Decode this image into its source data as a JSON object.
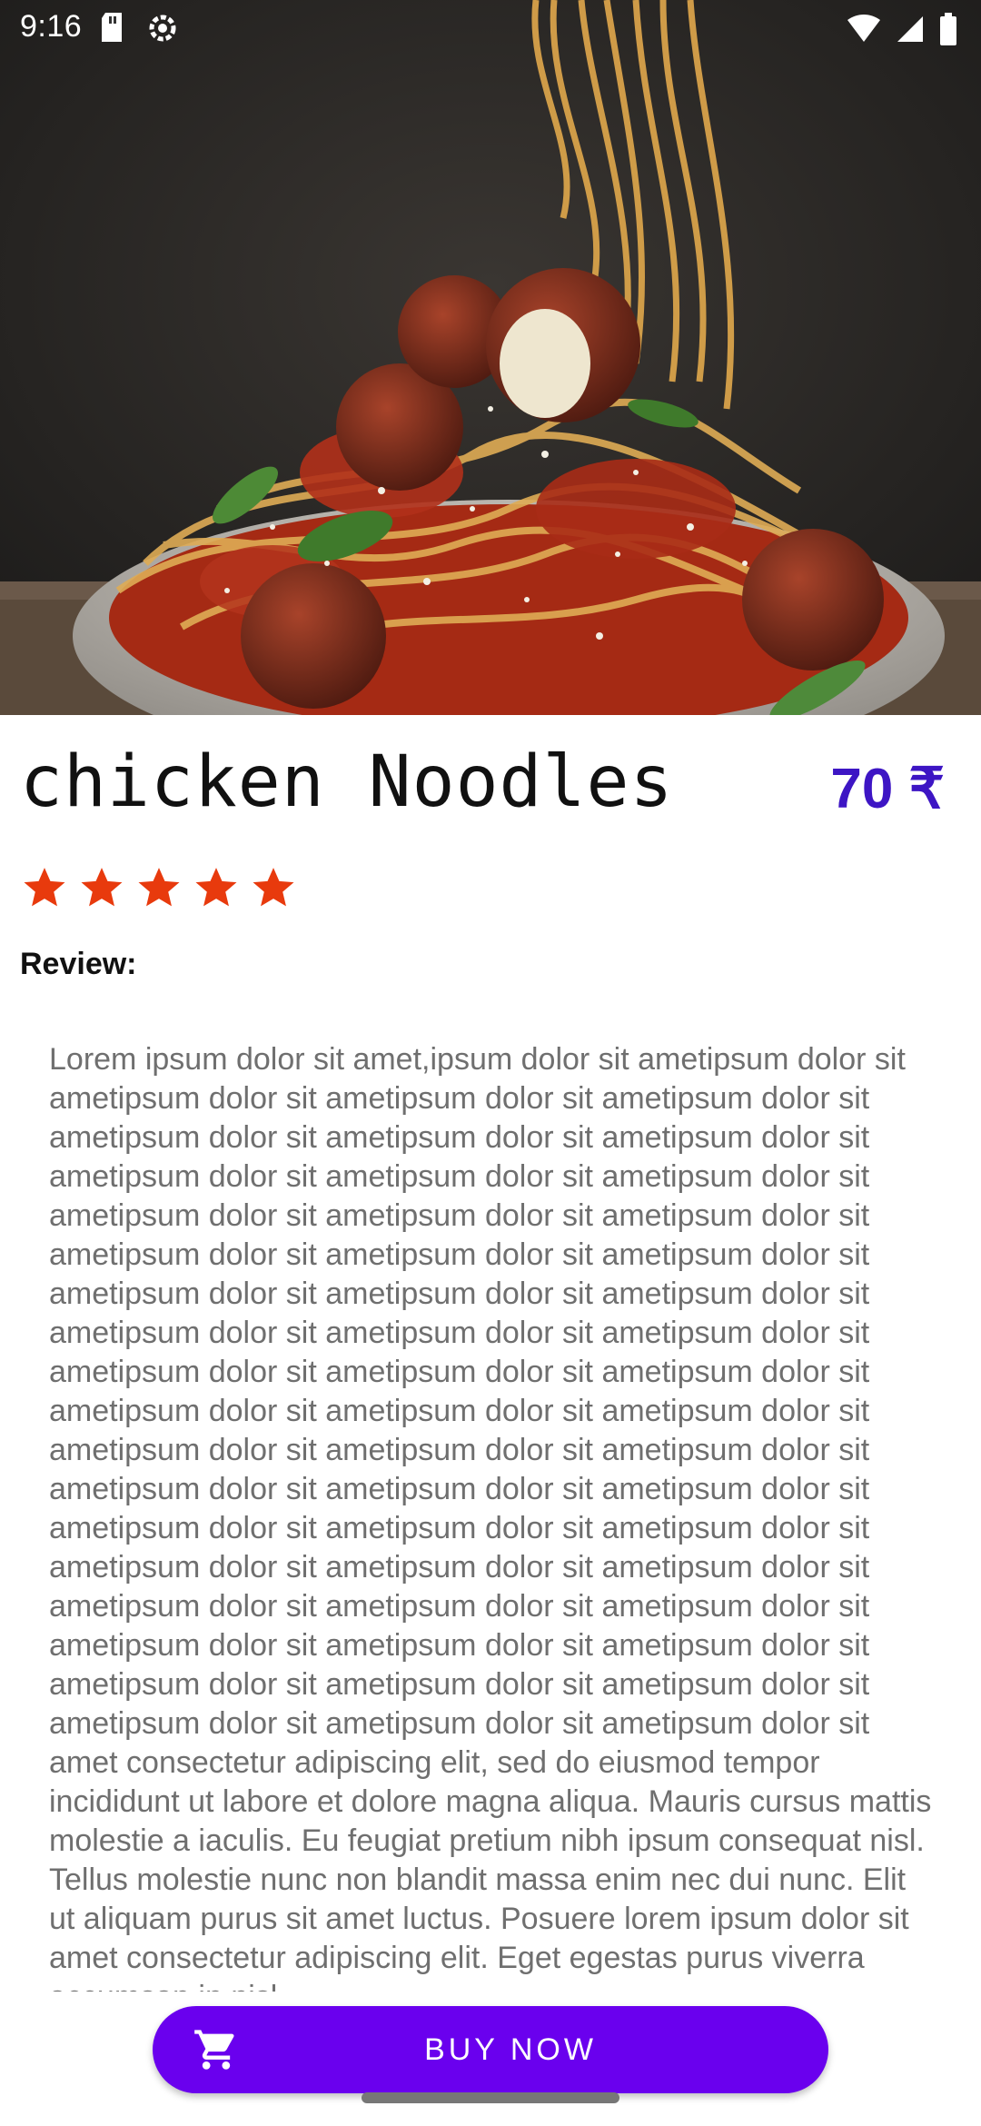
{
  "status_bar": {
    "time": "9:16",
    "left_icons": [
      "sd-card-icon",
      "settings-icon"
    ],
    "right_icons": [
      "wifi-icon",
      "cellular-signal-icon",
      "battery-icon"
    ]
  },
  "hero": {
    "image_subject": "spaghetti-meatballs-photo"
  },
  "product": {
    "title": "chicken Noodles",
    "price": "70 ₹",
    "rating_stars": 5,
    "star_color": "#e83a0d",
    "price_color": "#3d15c4"
  },
  "review": {
    "heading": "Review:",
    "text": "Lorem ipsum dolor sit amet,ipsum dolor sit ametipsum dolor sit ametipsum dolor sit ametipsum dolor sit ametipsum dolor sit ametipsum dolor sit ametipsum dolor sit ametipsum dolor sit ametipsum dolor sit ametipsum dolor sit ametipsum dolor sit ametipsum dolor sit ametipsum dolor sit ametipsum dolor sit ametipsum dolor sit ametipsum dolor sit ametipsum dolor sit ametipsum dolor sit ametipsum dolor sit ametipsum dolor sit ametipsum dolor sit ametipsum dolor sit ametipsum dolor sit ametipsum dolor sit ametipsum dolor sit ametipsum dolor sit ametipsum dolor sit ametipsum dolor sit ametipsum dolor sit ametipsum dolor sit ametipsum dolor sit ametipsum dolor sit ametipsum dolor sit ametipsum dolor sit ametipsum dolor sit ametipsum dolor sit ametipsum dolor sit ametipsum dolor sit ametipsum dolor sit ametipsum dolor sit ametipsum dolor sit ametipsum dolor sit ametipsum dolor sit ametipsum dolor sit ametipsum dolor sit ametipsum dolor sit ametipsum dolor sit ametipsum dolor sit ametipsum dolor sit ametipsum dolor sit ametipsum dolor sit ametipsum dolor sit ametipsum dolor sit amet consectetur adipiscing elit, sed do eiusmod tempor incididunt ut labore et dolore magna aliqua. Mauris cursus mattis molestie a iaculis. Eu feugiat pretium nibh ipsum consequat nisl. Tellus molestie nunc non blandit massa enim nec dui nunc. Elit ut aliquam purus sit amet luctus. Posuere lorem ipsum dolor sit amet consectetur adipiscing elit. Eget egestas purus viverra accumsan in nisl"
  },
  "buy_button": {
    "label": "BUY NOW",
    "icon": "shopping-cart-icon",
    "color": "#6a00ee"
  }
}
